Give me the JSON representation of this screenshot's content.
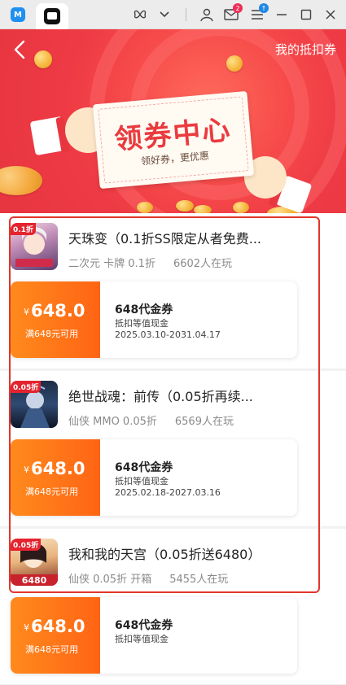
{
  "titlebar": {
    "app_icon": "memu-icon",
    "active_tab_icon": "game-app-icon",
    "mail_badge": "2",
    "menu_badge": "↑"
  },
  "header": {
    "back_icon": "chevron-left-icon",
    "my_coupons_label": "我的抵扣券",
    "banner_title": "领券中心",
    "banner_subtitle": "领好券，更优惠"
  },
  "games": [
    {
      "name": "天珠变（0.1折SS限定从者免费...",
      "tags": "二次元 卡牌 0.1折",
      "players": "6602人在玩",
      "discount_tag": "0.1折",
      "coupon": {
        "currency": "¥",
        "amount": "648.0",
        "condition": "满648元可用",
        "title": "648代金券",
        "desc": "抵扣等值现金",
        "validity": "2025.03.10-2031.04.17"
      }
    },
    {
      "name": "绝世战魂：前传（0.05折再续...",
      "tags": "仙侠 MMO 0.05折",
      "players": "6569人在玩",
      "discount_tag": "0.05折",
      "coupon": {
        "currency": "¥",
        "amount": "648.0",
        "condition": "满648元可用",
        "title": "648代金券",
        "desc": "抵扣等值现金",
        "validity": "2025.02.18-2027.03.16"
      }
    },
    {
      "name": "我和我的天宫（0.05折送6480）",
      "tags": "仙侠 0.05折 开箱",
      "players": "5455人在玩",
      "discount_tag": "0.05折",
      "coupon": {
        "currency": "¥",
        "amount": "648.0",
        "condition": "满648元可用",
        "title": "648代金券",
        "desc": "抵扣等值现金",
        "validity": ""
      }
    }
  ],
  "colors": {
    "accent_red": "#e7353f",
    "coupon_orange": "#ff6414",
    "highlight": "#e0362a"
  }
}
